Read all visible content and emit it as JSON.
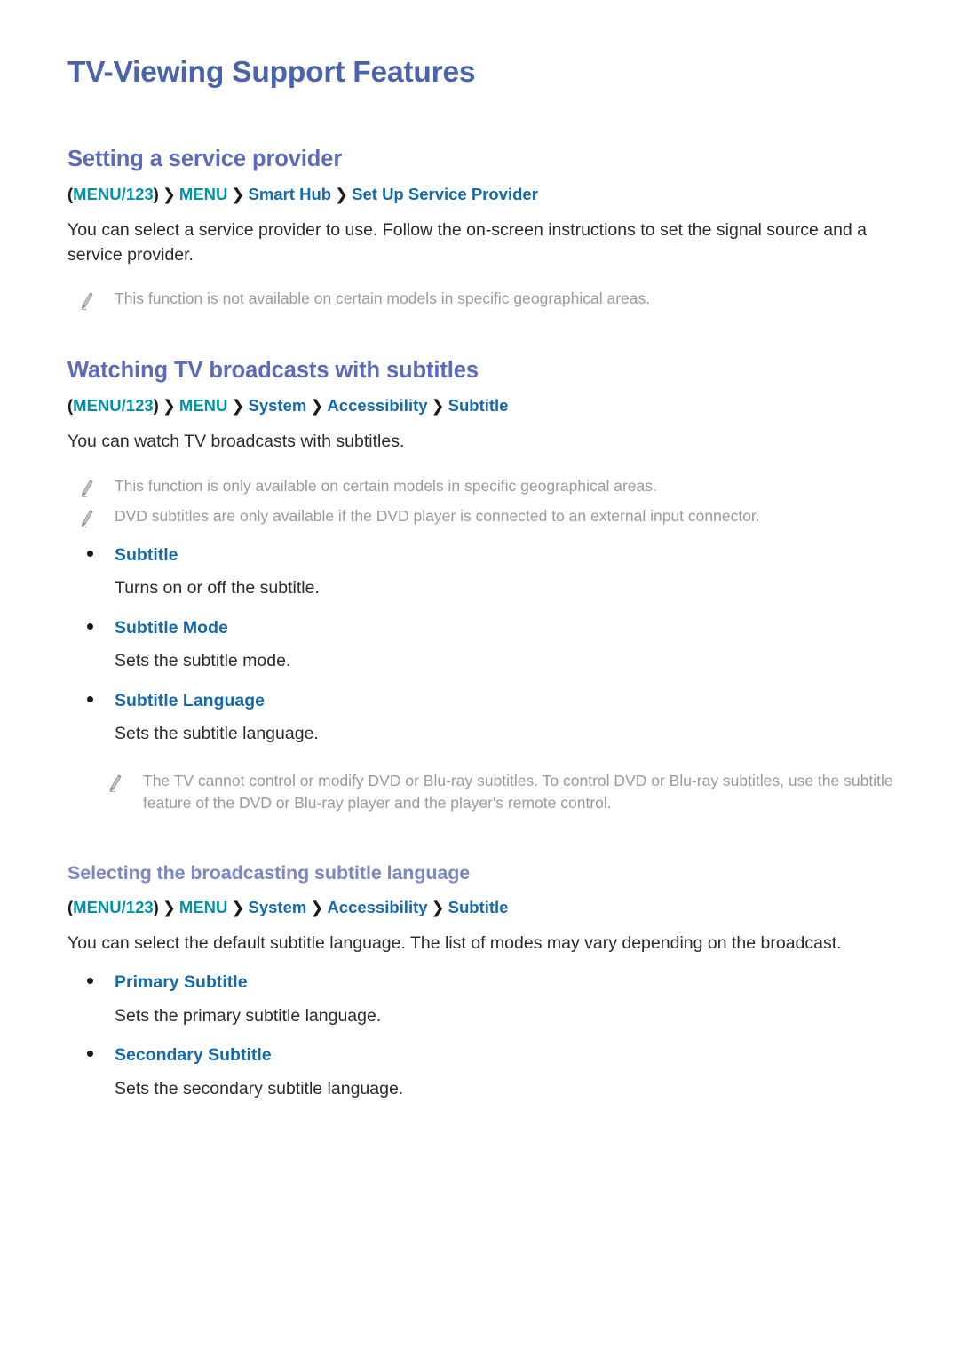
{
  "document": {
    "title": "TV-Viewing Support Features"
  },
  "colors": {
    "page_title": "#4a63ad",
    "h2": "#5b6abf",
    "h3": "#7b86c9",
    "menu_key": "#0093a8",
    "menu_item": "#1569b0",
    "bullet_label": "#1569b0",
    "body_text": "#2b2b2b",
    "note_text": "#9a9a9a",
    "background": "#ffffff"
  },
  "icons": {
    "note": "pencil-icon",
    "chevron": "chevron-right-separator",
    "bullet": "bullet-dot"
  },
  "sections": [
    {
      "heading": "Setting a service provider",
      "menu_path": {
        "open_paren": "(",
        "key": "MENU/123",
        "close_paren": ")",
        "separator": "❯",
        "items": [
          "MENU",
          "Smart Hub",
          "Set Up Service Provider"
        ]
      },
      "paragraph": "You can select a service provider to use. Follow the on-screen instructions to set the signal source and a service provider.",
      "notes": [
        "This function is not available on certain models in specific geographical areas."
      ]
    },
    {
      "heading": "Watching TV broadcasts with subtitles",
      "menu_path": {
        "open_paren": "(",
        "key": "MENU/123",
        "close_paren": ")",
        "separator": "❯",
        "items": [
          "MENU",
          "System",
          "Accessibility",
          "Subtitle"
        ]
      },
      "paragraph": "You can watch TV broadcasts with subtitles.",
      "notes": [
        "This function is only available on certain models in specific geographical areas.",
        "DVD subtitles are only available if the DVD player is connected to an external input connector."
      ],
      "bullets": [
        {
          "label": "Subtitle",
          "description": "Turns on or off the subtitle."
        },
        {
          "label": "Subtitle Mode",
          "description": "Sets the subtitle mode."
        },
        {
          "label": "Subtitle Language",
          "description": "Sets the subtitle language."
        }
      ],
      "trailing_notes": [
        "The TV cannot control or modify DVD or Blu-ray subtitles. To control DVD or Blu-ray subtitles, use the subtitle feature of the DVD or Blu-ray player and the player's remote control."
      ],
      "subsection": {
        "heading": "Selecting the broadcasting subtitle language",
        "menu_path": {
          "open_paren": "(",
          "key": "MENU/123",
          "close_paren": ")",
          "separator": "❯",
          "items": [
            "MENU",
            "System",
            "Accessibility",
            "Subtitle"
          ]
        },
        "paragraph": "You can select the default subtitle language. The list of modes may vary depending on the broadcast.",
        "bullets": [
          {
            "label": "Primary Subtitle",
            "description": "Sets the primary subtitle language."
          },
          {
            "label": "Secondary Subtitle",
            "description": "Sets the secondary subtitle language."
          }
        ]
      }
    }
  ]
}
